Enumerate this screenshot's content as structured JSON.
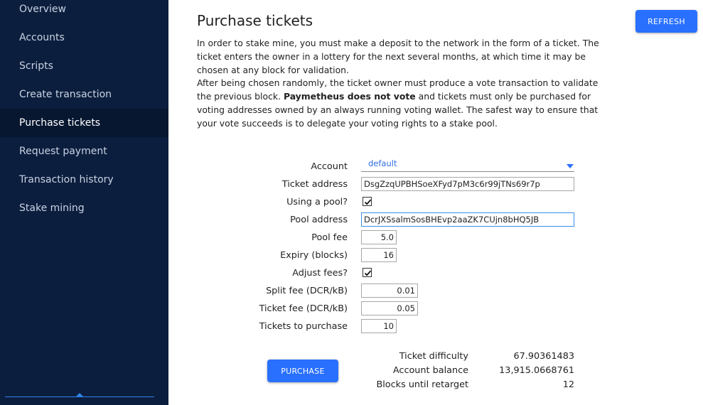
{
  "sidebar": {
    "items": [
      {
        "label": "Overview",
        "active": false
      },
      {
        "label": "Accounts",
        "active": false
      },
      {
        "label": "Scripts",
        "active": false
      },
      {
        "label": "Create transaction",
        "active": false
      },
      {
        "label": "Purchase tickets",
        "active": true
      },
      {
        "label": "Request payment",
        "active": false
      },
      {
        "label": "Transaction history",
        "active": false
      },
      {
        "label": "Stake mining",
        "active": false
      }
    ]
  },
  "page": {
    "title": "Purchase tickets",
    "refresh_label": "REFRESH",
    "description": {
      "p1": "In order to stake mine, you must make a deposit to the network in the form of a ticket. The ticket enters the owner in a lottery for the next several months, at which time it may be chosen at any block for validation.",
      "p2_start": "After being chosen randomly, the ticket owner must produce a vote transaction to validate the previous block. ",
      "p2_bold": "Paymetheus does not vote",
      "p2_end": " and tickets must only be purchased for voting addresses owned by an always running voting wallet. The safest way to ensure that your vote succeeds is to delegate your voting rights to a stake pool."
    }
  },
  "form": {
    "account": {
      "label": "Account",
      "value": "default"
    },
    "ticket_address": {
      "label": "Ticket address",
      "value": "DsgZzqUPBHSoeXFyd7pM3c6r99jTNs69r7p"
    },
    "using_pool": {
      "label": "Using a pool?",
      "checked": true
    },
    "pool_address": {
      "label": "Pool address",
      "value": "DcrJXSsalmSosBHEvp2aaZK7CUjn8bHQ5JB"
    },
    "pool_fee": {
      "label": "Pool fee",
      "value": "5.0"
    },
    "expiry": {
      "label": "Expiry (blocks)",
      "value": "16"
    },
    "adjust_fees": {
      "label": "Adjust fees?",
      "checked": true
    },
    "split_fee": {
      "label": "Split fee (DCR/kB)",
      "value": "0.01"
    },
    "ticket_fee": {
      "label": "Ticket fee (DCR/kB)",
      "value": "0.05"
    },
    "tickets_to_purchase": {
      "label": "Tickets to purchase",
      "value": "10"
    }
  },
  "purchase_label": "PURCHASE",
  "stats": {
    "ticket_difficulty": {
      "label": "Ticket difficulty",
      "value": "67.90361483"
    },
    "account_balance": {
      "label": "Account balance",
      "value": "13,915.0668761"
    },
    "blocks_until_retarget": {
      "label": "Blocks until retarget",
      "value": "12"
    }
  },
  "colors": {
    "sidebar_bg": "#0c1e3e",
    "sidebar_active_bg": "#081730",
    "accent": "#2970ff"
  }
}
